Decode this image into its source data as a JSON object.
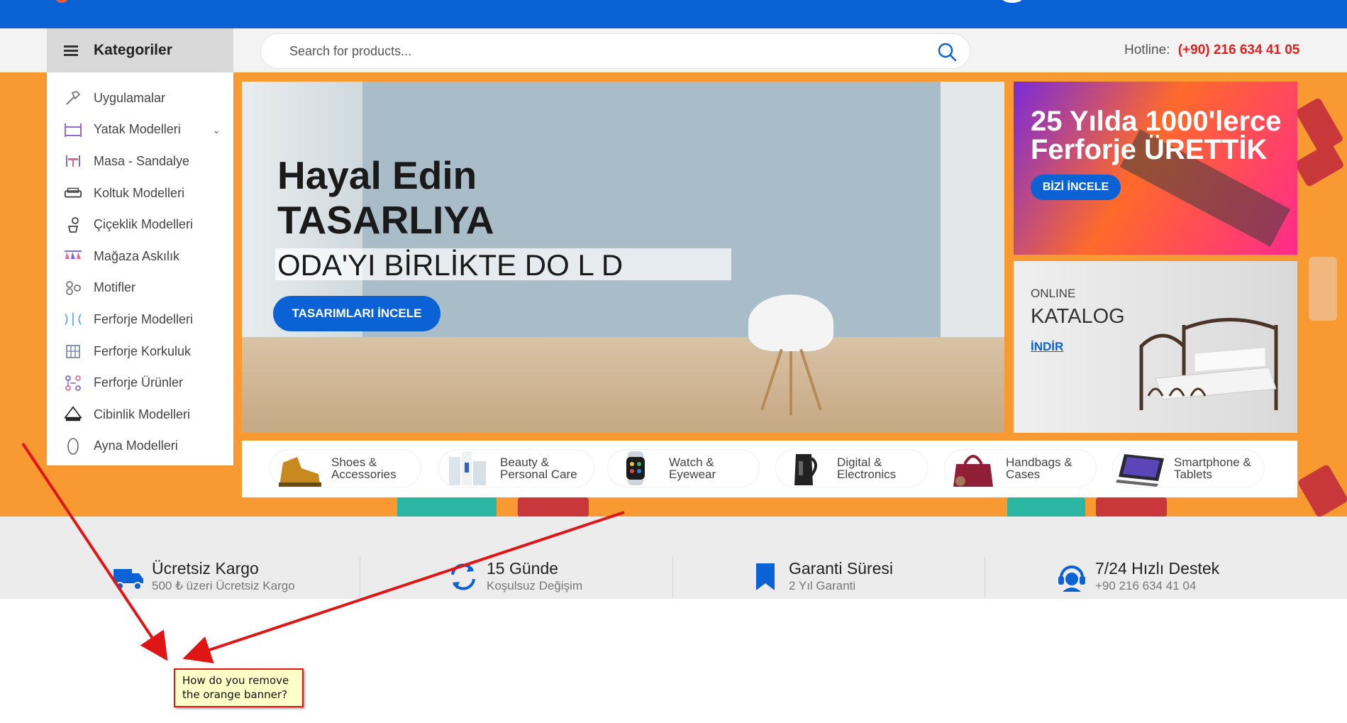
{
  "header": {
    "categories_label": "Kategoriler",
    "search_placeholder": "Search for products...",
    "hotline_label": "Hotline:",
    "hotline_number": "(+90) 216 634 41 05"
  },
  "sidebar": {
    "items": [
      {
        "label": "Uygulamalar",
        "icon": "hammer-icon"
      },
      {
        "label": "Yatak Modelleri",
        "icon": "bed-icon",
        "has_children": true
      },
      {
        "label": "Masa - Sandalye",
        "icon": "table-chairs-icon"
      },
      {
        "label": "Koltuk Modelleri",
        "icon": "sofa-icon"
      },
      {
        "label": "Çiçeklik Modelleri",
        "icon": "flower-pot-icon"
      },
      {
        "label": "Mağaza Askılık",
        "icon": "clothes-rack-icon"
      },
      {
        "label": "Motifler",
        "icon": "motif-icon"
      },
      {
        "label": "Ferforje Modelleri",
        "icon": "wrought-iron-icon"
      },
      {
        "label": "Ferforje Korkuluk",
        "icon": "railing-icon"
      },
      {
        "label": "Ferforje Ürünler",
        "icon": "ironwork-icon"
      },
      {
        "label": "Cibinlik Modelleri",
        "icon": "canopy-icon"
      },
      {
        "label": "Ayna Modelleri",
        "icon": "mirror-icon"
      }
    ],
    "chevron": "⌄"
  },
  "hero": {
    "line1": "Hayal Edin",
    "line2": "TASARLIYA",
    "line3": "ODA'YI BİRLİKTE DO  L    D",
    "button": "TASARIMLARI İNCELE"
  },
  "promo1": {
    "title_line1": "25 Yılda 1000'lerce",
    "title_line2": "Ferforje ÜRETTİK",
    "button": "BİZİ İNCELE"
  },
  "promo2": {
    "small": "ONLINE",
    "big": "KATALOG",
    "link": "İNDİR"
  },
  "categories_strip": [
    {
      "line1": "Shoes &",
      "line2": "Accessories"
    },
    {
      "line1": "Beauty &",
      "line2": "Personal Care"
    },
    {
      "line1": "Watch &",
      "line2": "Eyewear"
    },
    {
      "line1": "Digital &",
      "line2": "Electronics"
    },
    {
      "line1": "Handbags &",
      "line2": "Cases"
    },
    {
      "line1": "Smartphone &",
      "line2": "Tablets"
    }
  ],
  "features": [
    {
      "title": "Ücretsiz Kargo",
      "sub": "500 ₺ üzeri Ücretsiz Kargo",
      "icon": "truck-icon"
    },
    {
      "title": "15 Günde",
      "sub": "Koşulsuz Değişim",
      "icon": "refresh-icon"
    },
    {
      "title": "Garanti Süresi",
      "sub": "2 Yıl Garanti",
      "icon": "bookmark-icon"
    },
    {
      "title": "7/24 Hızlı Destek",
      "sub": "+90 216 634 41 04",
      "icon": "support-icon"
    }
  ],
  "annotation": {
    "line1": "How do you remove",
    "line2": "the orange banner?"
  },
  "colors": {
    "brand_blue": "#0a62d4",
    "orange_banner": "#f89a31",
    "hotline_red": "#e0201f",
    "arrow_red": "#e01616"
  }
}
